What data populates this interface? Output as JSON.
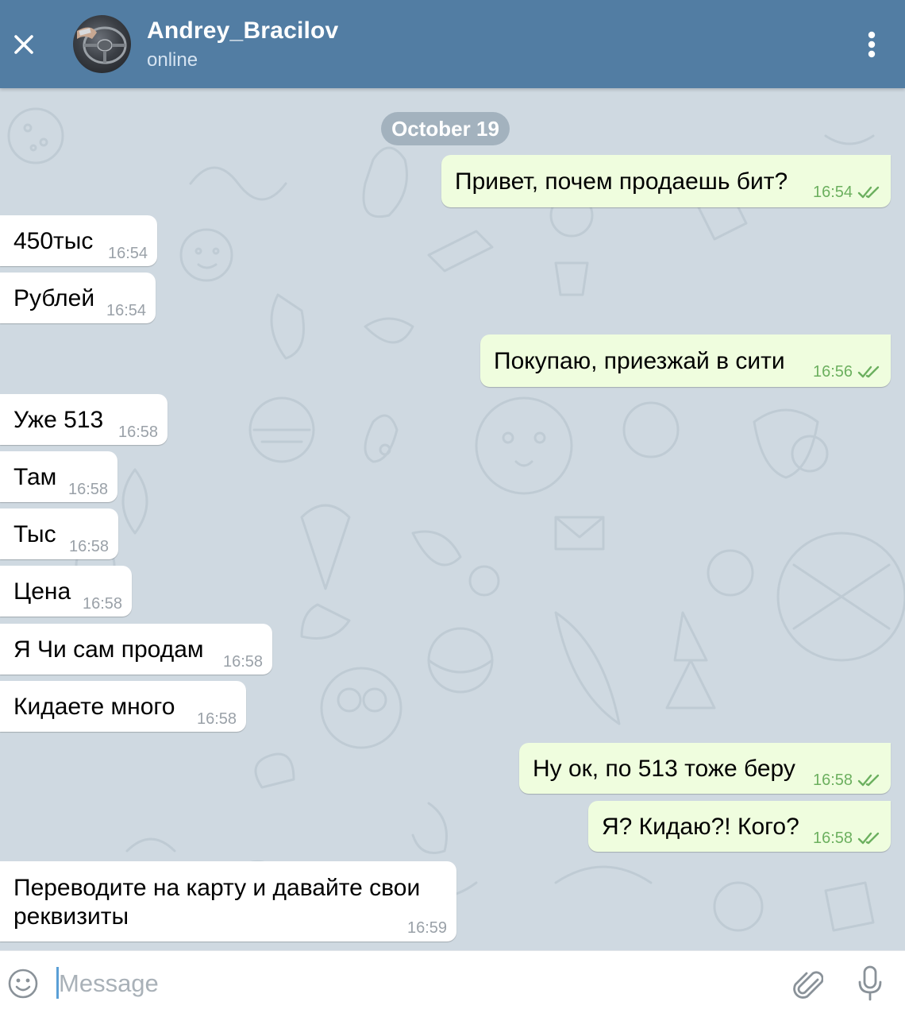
{
  "header": {
    "contact_name": "Andrey_Bracilov",
    "status": "online",
    "close_icon": "close-icon",
    "menu_icon": "more-vertical-icon",
    "color": "#527da3"
  },
  "chat": {
    "date": "October 19",
    "messages": [
      {
        "direction": "out",
        "text": "Привет, почем продаешь бит?",
        "time": "16:54",
        "read": true
      },
      {
        "direction": "in",
        "text": "450тыс",
        "time": "16:54"
      },
      {
        "direction": "in",
        "text": "Рублей",
        "time": "16:54"
      },
      {
        "direction": "out",
        "text": "Покупаю, приезжай в сити",
        "time": "16:56",
        "read": true
      },
      {
        "direction": "in",
        "text": "Уже 513",
        "time": "16:58"
      },
      {
        "direction": "in",
        "text": "Там",
        "time": "16:58"
      },
      {
        "direction": "in",
        "text": "Тыс",
        "time": "16:58"
      },
      {
        "direction": "in",
        "text": "Цена",
        "time": "16:58"
      },
      {
        "direction": "in",
        "text": "Я Чи сам продам",
        "time": "16:58"
      },
      {
        "direction": "in",
        "text": "Кидаете много",
        "time": "16:58"
      },
      {
        "direction": "out",
        "text": "Ну ок, по 513 тоже беру",
        "time": "16:58",
        "read": true
      },
      {
        "direction": "out",
        "text": "Я? Кидаю?! Кого?",
        "time": "16:58",
        "read": true
      },
      {
        "direction": "in",
        "text_line1": "Переводите на карту и давайте свои",
        "text_line2": "реквизиты",
        "time": "16:59"
      }
    ],
    "incoming_color": "#ffffff",
    "outgoing_color": "#effdde",
    "read_check_color": "#6cb05f"
  },
  "composer": {
    "placeholder": "Message",
    "value": "",
    "emoji_icon": "emoji-icon",
    "attach_icon": "paperclip-icon",
    "mic_icon": "microphone-icon"
  }
}
